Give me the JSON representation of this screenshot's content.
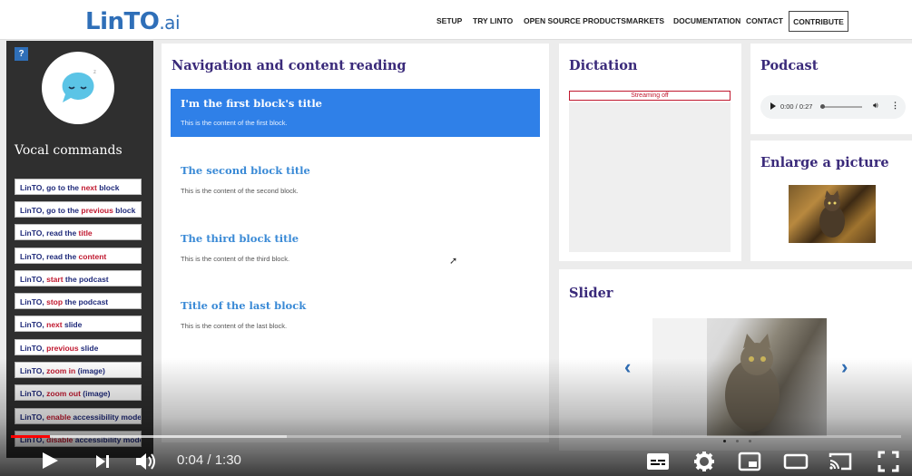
{
  "header": {
    "logo_main": "LinTO",
    "logo_suffix": ".ai",
    "nav": [
      "SETUP",
      "TRY LINTO",
      "OPEN SOURCE PRODUCTS",
      "MARKETS",
      "DOCUMENTATION",
      "CONTACT"
    ],
    "contribute_label": "CONTRIBUTE"
  },
  "sidebar": {
    "help_label": "?",
    "avatar_badge": "z",
    "title": "Vocal commands",
    "commands": [
      {
        "pre": "LinTO, go to the ",
        "kw": "next",
        "post": " block"
      },
      {
        "pre": "LinTO, go to the ",
        "kw": "previous",
        "post": " block"
      },
      {
        "pre": "LinTO, read the ",
        "kw": "title",
        "post": ""
      },
      {
        "pre": "LinTO, read the ",
        "kw": "content",
        "post": ""
      },
      {
        "pre": "LinTO, ",
        "kw": "start",
        "post": " the podcast"
      },
      {
        "pre": "LinTO, ",
        "kw": "stop",
        "post": " the podcast"
      },
      {
        "pre": "LinTO, ",
        "kw": "next",
        "post": " slide"
      },
      {
        "pre": "LinTO, ",
        "kw": "previous",
        "post": " slide"
      },
      {
        "pre": "LinTO, ",
        "kw": "zoom in",
        "post": " (image)"
      },
      {
        "pre": "LinTO, ",
        "kw": "zoom out",
        "post": " (image)"
      },
      {
        "pre": "LinTO, ",
        "kw": "enable",
        "post": " accessibility mode"
      },
      {
        "pre": "LinTO, ",
        "kw": "disable",
        "post": " accessibility mode"
      }
    ]
  },
  "navigation": {
    "title": "Navigation and content reading",
    "blocks": [
      {
        "title": "I'm the first block's title",
        "content": "This is the content of the first block.",
        "active": true
      },
      {
        "title": "The second block title",
        "content": "This is the content of the second block.",
        "active": false
      },
      {
        "title": "The third block title",
        "content": "This is the content of the third block.",
        "active": false
      },
      {
        "title": "Title of the last block",
        "content": "This is the content of the last block.",
        "active": false
      }
    ]
  },
  "dictation": {
    "title": "Dictation",
    "status": "Streaming off"
  },
  "podcast": {
    "title": "Podcast",
    "time": "0:00 / 0:27",
    "progress": 0.0
  },
  "enlarge": {
    "title": "Enlarge a picture"
  },
  "slider": {
    "title": "Slider",
    "prev_glyph": "‹",
    "next_glyph": "›",
    "slide_count": 3,
    "active_slide": 0
  },
  "player": {
    "time_readout": "0:04 / 1:30",
    "played_fraction": 0.044,
    "buffered_fraction": 0.31
  },
  "colors": {
    "brand_blue": "#2f6fb8",
    "active_block": "#2f80e8",
    "keyword_red": "#c0182f",
    "title_purple": "#3a2a7a",
    "progress_red": "#ff0000"
  }
}
